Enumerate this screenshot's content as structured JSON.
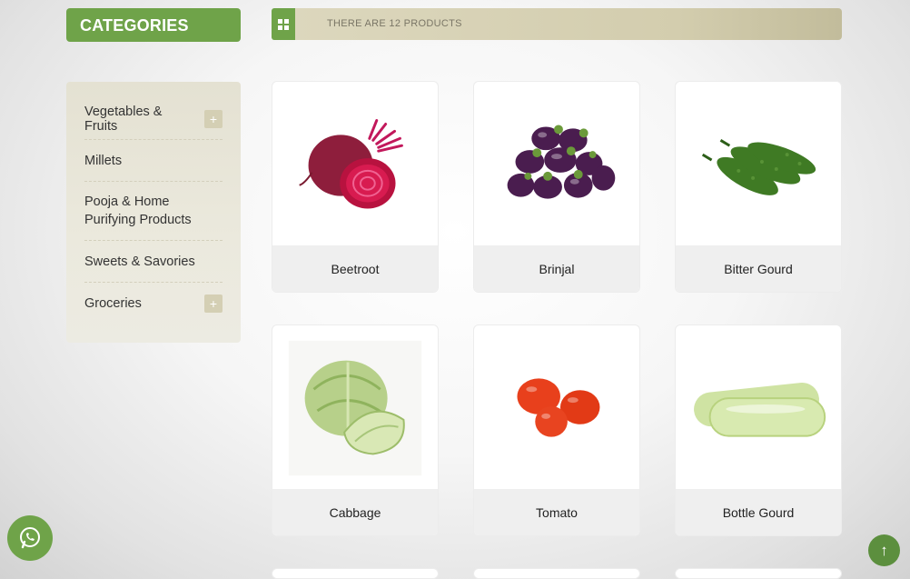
{
  "sidebar": {
    "title": "CATEGORIES",
    "items": [
      {
        "label": "Vegetables & Fruits",
        "expandable": true
      },
      {
        "label": "Millets",
        "expandable": false
      },
      {
        "label": "Pooja & Home Purifying Products",
        "expandable": false
      },
      {
        "label": "Sweets & Savories",
        "expandable": false
      },
      {
        "label": "Groceries",
        "expandable": true
      }
    ],
    "expand_symbol": "+"
  },
  "toolbar": {
    "view_icon": "grid-icon",
    "product_count_text": "THERE ARE 12 PRODUCTS"
  },
  "products": [
    {
      "name": "Beetroot",
      "image": "beetroot"
    },
    {
      "name": "Brinjal",
      "image": "brinjal"
    },
    {
      "name": "Bitter Gourd",
      "image": "bitter-gourd"
    },
    {
      "name": "Cabbage",
      "image": "cabbage"
    },
    {
      "name": "Tomato",
      "image": "tomato"
    },
    {
      "name": "Bottle Gourd",
      "image": "bottle-gourd"
    }
  ],
  "floating": {
    "whatsapp_icon": "whatsapp-icon",
    "scroll_top_symbol": "↑"
  },
  "colors": {
    "accent": "#6fa349",
    "toolbar_bg": "#d3cdae",
    "panel_bg": "#e8e5d8"
  }
}
